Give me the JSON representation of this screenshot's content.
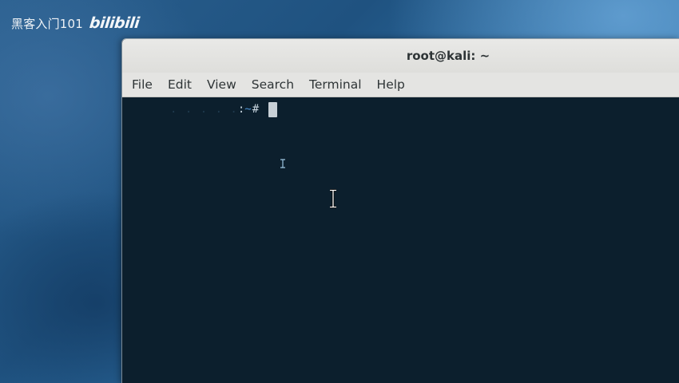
{
  "watermark": {
    "channel_text": "黑客入门101",
    "logo_text": "bilibili"
  },
  "window": {
    "title": "root@kali: ~"
  },
  "menu": {
    "items": [
      {
        "label": "File"
      },
      {
        "label": "Edit"
      },
      {
        "label": "View"
      },
      {
        "label": "Search"
      },
      {
        "label": "Terminal"
      },
      {
        "label": "Help"
      }
    ]
  },
  "terminal": {
    "prompt_separator": ":",
    "prompt_path": "~",
    "prompt_symbol": "#"
  },
  "icons": {
    "text_cursor_small": "ibeam-icon",
    "text_cursor_large": "ibeam-icon"
  },
  "colors": {
    "terminal_background": "#0c1f2d",
    "titlebar_background": "#e4e4e2",
    "prompt_path": "#4a8fd0",
    "desktop_accent": "#2e6ea3"
  }
}
